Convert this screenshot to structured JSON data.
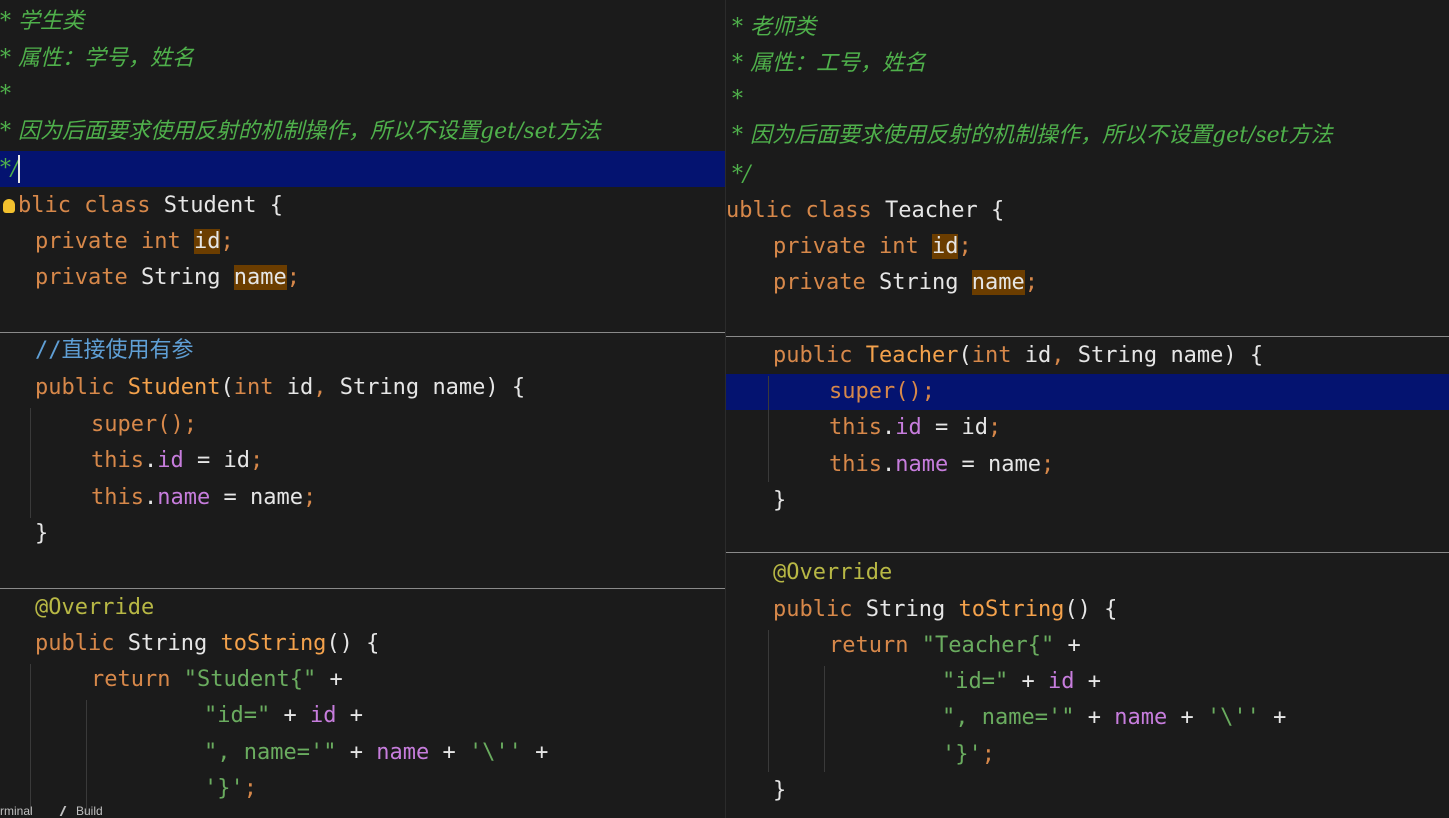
{
  "left_editor": {
    "comment_class": "* 学生类",
    "comment_attrs": "* 属性：学号，姓名",
    "comment_blank": "*",
    "comment_reason": "* 因为后面要求使用反射的机制操作，所以不设置get/set方法",
    "comment_end": "*/",
    "class_decl": {
      "kw_public": "blic",
      "kw_class": "class",
      "name": "Student",
      "brace": "{"
    },
    "fields": [
      {
        "kw_private": "private",
        "type": "int",
        "name": "id",
        "semi": ";"
      },
      {
        "kw_private": "private",
        "type": "String",
        "name": "name",
        "semi": ";"
      }
    ],
    "ctor_comment": "//直接使用有参",
    "ctor": {
      "kw_public": "public",
      "name": "Student",
      "open": "(",
      "t1": "int",
      "p1": "id",
      "comma": ",",
      "t2": "String",
      "p2": "name",
      "close": ") {"
    },
    "super_call": "super",
    "super_rest": "();",
    "this_kw": "this",
    "dot": ".",
    "assign_id": " = id",
    "assign_name": " = name",
    "semi": ";",
    "field_id": "id",
    "field_name": "name",
    "close_brace": "}",
    "override": "@Override",
    "tostring": {
      "kw_public": "public",
      "type": "String",
      "name": "toString",
      "rest": "() {"
    },
    "return_kw": "return",
    "str_class": "\"Student{\"",
    "plus": "+",
    "str_id": "\"id=\"",
    "str_name": "\", name='\"",
    "str_quote": "'\\''",
    "str_end": "'}'",
    "end_semi": ";"
  },
  "right_editor": {
    "comment_class": "* 老师类",
    "comment_attrs": "* 属性：工号，姓名",
    "comment_blank": "*",
    "comment_reason": "* 因为后面要求使用反射的机制操作，所以不设置get/set方法",
    "comment_end": "*/",
    "class_decl": {
      "kw_public": "ublic",
      "kw_class": "class",
      "name": "Teacher",
      "brace": "{"
    },
    "fields": [
      {
        "kw_private": "private",
        "type": "int",
        "name": "id",
        "semi": ";"
      },
      {
        "kw_private": "private",
        "type": "String",
        "name": "name",
        "semi": ";"
      }
    ],
    "ctor": {
      "kw_public": "public",
      "name": "Teacher",
      "open": "(",
      "t1": "int",
      "p1": "id",
      "comma": ",",
      "t2": "String",
      "p2": "name",
      "close": ") {"
    },
    "super_call": "super",
    "super_rest": "();",
    "this_kw": "this",
    "dot": ".",
    "assign_id": " = id",
    "assign_name": " = name",
    "semi": ";",
    "field_id": "id",
    "field_name": "name",
    "close_brace": "}",
    "override": "@Override",
    "tostring": {
      "kw_public": "public",
      "type": "String",
      "name": "toString",
      "rest": "() {"
    },
    "return_kw": "return",
    "str_class": "\"Teacher{\"",
    "plus": "+",
    "str_id": "\"id=\"",
    "str_name": "\", name='\"",
    "str_quote": "'\\''",
    "str_end": "'}'",
    "end_semi": ";"
  },
  "bottom_bar": {
    "terminal_tab": "rminal",
    "build_tab": "Build"
  },
  "colors": {
    "background": "#1b1b1b",
    "selection": "#041370",
    "comment": "#4fb04b",
    "keyword": "#d7884a",
    "method": "#f4a24c",
    "field": "#c77ddd",
    "string": "#6aac5f",
    "annotation": "#b8b845",
    "occurrence_highlight": "#6b3d00"
  },
  "icons": {
    "intention_bulb": "lightbulb-icon",
    "build_tab_icon": "hammer-icon"
  }
}
